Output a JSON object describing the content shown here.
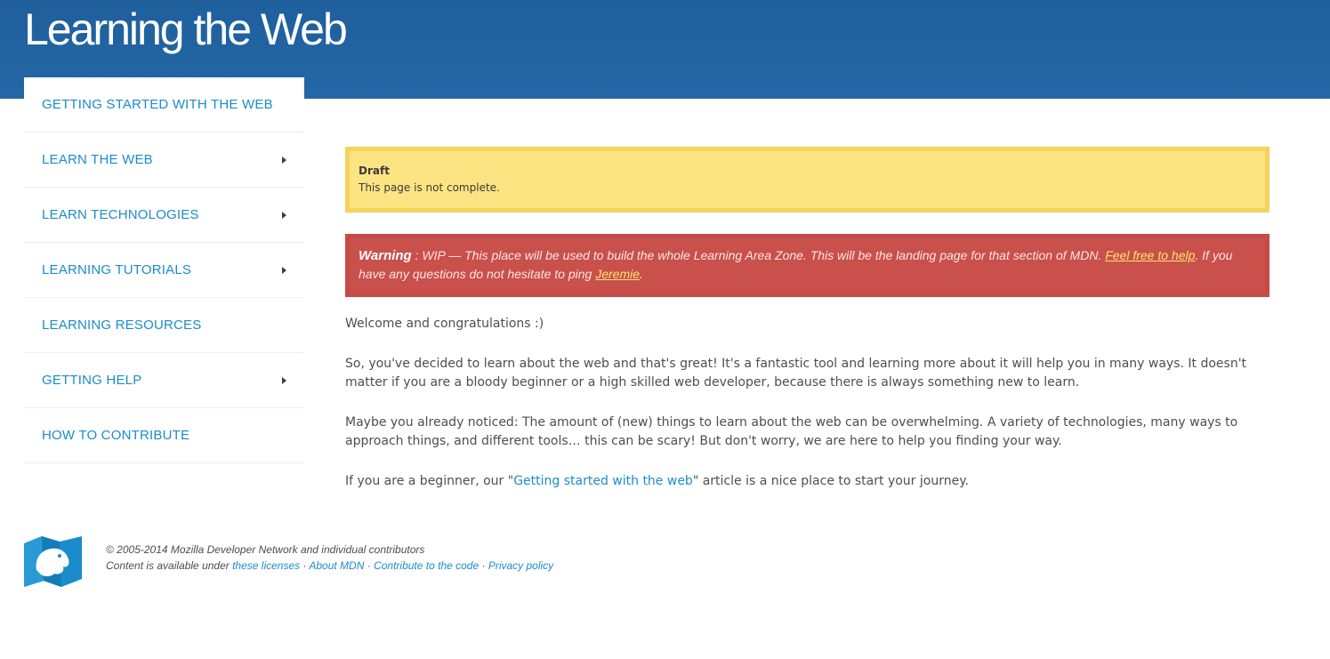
{
  "header": {
    "title": "Learning the Web"
  },
  "sidebar": {
    "items": [
      {
        "label": "Getting started with the web"
      },
      {
        "label": "Learn the Web"
      },
      {
        "label": "Learn technologies"
      },
      {
        "label": "Learning tutorials"
      },
      {
        "label": "Learning resources"
      },
      {
        "label": "Getting help"
      },
      {
        "label": "How to contribute"
      }
    ]
  },
  "draft": {
    "title": "Draft",
    "text": "This page is not complete."
  },
  "warning": {
    "label": "Warning",
    "sep": " : ",
    "text1": "WIP — This place will be used to build the whole Learning Area Zone. This will be the landing page for that section of MDN. ",
    "link1": "Feel free to help",
    "text2": ". If you have any questions do not hesitate to ping ",
    "link2": "Jeremie",
    "text3": "."
  },
  "content": {
    "p1": "Welcome and congratulations :)",
    "p2": "So, you've decided to learn about the web and that's great! It's a fantastic tool and learning more about it will help you in many ways. It doesn't matter if you are a bloody beginner or a high skilled web developer, because there is always something new to learn.",
    "p3": "Maybe you already noticed: The amount of (new) things to learn about the web can be overwhelming. A variety of technologies, many ways to approach things, and different tools… this can be scary! But don't worry, we are here to help you finding your way.",
    "p4_before": "If you are a beginner, our \"",
    "p4_link": "Getting started with the web",
    "p4_after": "\" article is a nice place to start your journey."
  },
  "footer": {
    "copyright": "© 2005-2014 Mozilla Developer Network and individual contributors",
    "content_prefix": "Content is available under ",
    "licenses": "these licenses",
    "sep": " · ",
    "about": "About MDN",
    "contribute": "Contribute to the code",
    "privacy": "Privacy policy"
  },
  "colors": {
    "header": "#2567a6",
    "link": "#1a8ccc",
    "draft_bg": "#fde482",
    "warning_bg": "#c9504b"
  }
}
